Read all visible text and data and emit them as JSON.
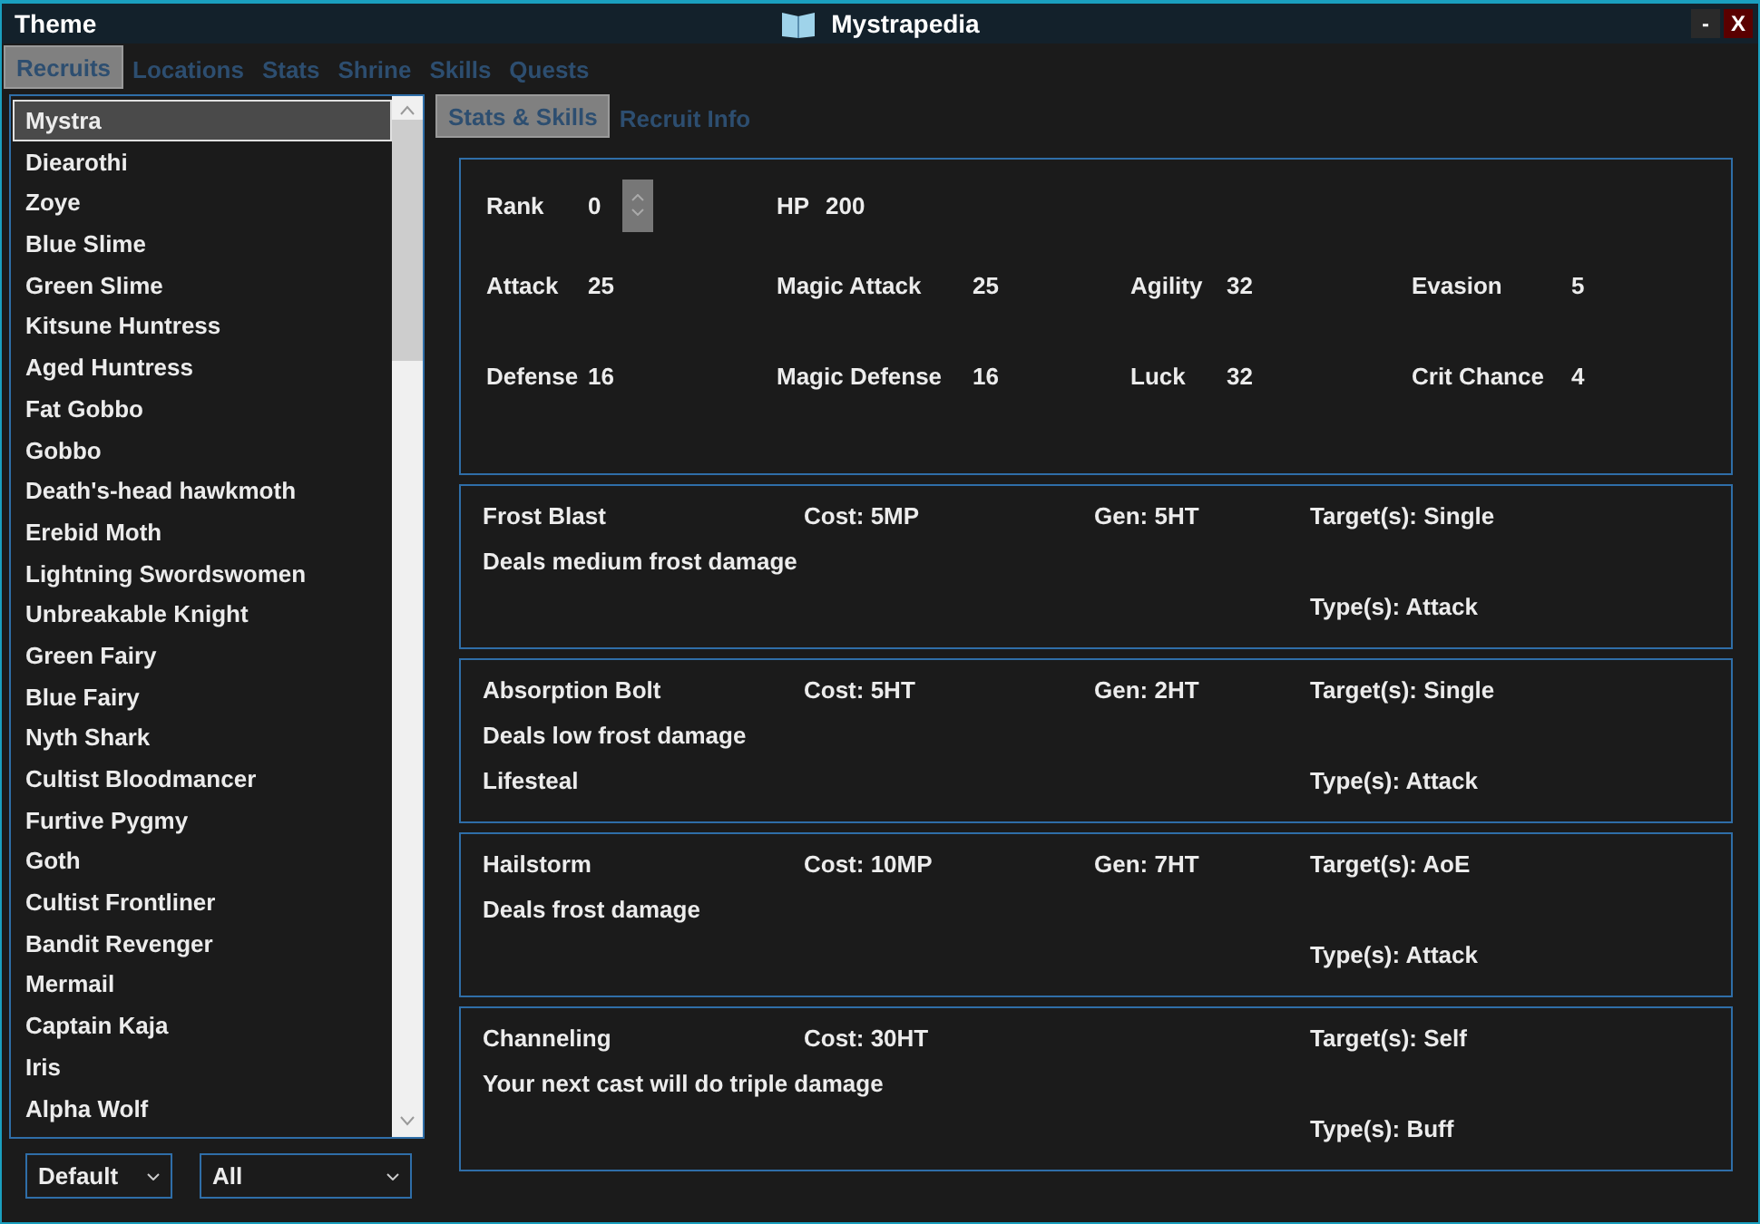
{
  "window": {
    "menu": "Theme",
    "title": "Mystrapedia",
    "minimize": "-",
    "close": "X"
  },
  "tabs": [
    {
      "label": "Recruits",
      "selected": true
    },
    {
      "label": "Locations",
      "selected": false
    },
    {
      "label": "Stats",
      "selected": false
    },
    {
      "label": "Shrine",
      "selected": false
    },
    {
      "label": "Skills",
      "selected": false
    },
    {
      "label": "Quests",
      "selected": false
    }
  ],
  "recruits": [
    {
      "name": "Mystra",
      "selected": true
    },
    {
      "name": "Diearothi",
      "selected": false
    },
    {
      "name": "Zoye",
      "selected": false
    },
    {
      "name": "Blue Slime",
      "selected": false
    },
    {
      "name": "Green Slime",
      "selected": false
    },
    {
      "name": "Kitsune Huntress",
      "selected": false
    },
    {
      "name": "Aged Huntress",
      "selected": false
    },
    {
      "name": "Fat Gobbo",
      "selected": false
    },
    {
      "name": "Gobbo",
      "selected": false
    },
    {
      "name": "Death's-head hawkmoth",
      "selected": false
    },
    {
      "name": "Erebid Moth",
      "selected": false
    },
    {
      "name": "Lightning Swordswomen",
      "selected": false
    },
    {
      "name": "Unbreakable Knight",
      "selected": false
    },
    {
      "name": "Green Fairy",
      "selected": false
    },
    {
      "name": "Blue Fairy",
      "selected": false
    },
    {
      "name": "Nyth Shark",
      "selected": false
    },
    {
      "name": "Cultist Bloodmancer",
      "selected": false
    },
    {
      "name": "Furtive Pygmy",
      "selected": false
    },
    {
      "name": "Goth",
      "selected": false
    },
    {
      "name": "Cultist Frontliner",
      "selected": false
    },
    {
      "name": "Bandit Revenger",
      "selected": false
    },
    {
      "name": "Mermail",
      "selected": false
    },
    {
      "name": "Captain Kaja",
      "selected": false
    },
    {
      "name": "Iris",
      "selected": false
    },
    {
      "name": "Alpha Wolf",
      "selected": false
    }
  ],
  "filters": [
    {
      "value": "Default"
    },
    {
      "value": "All"
    }
  ],
  "subtabs": [
    {
      "label": "Stats & Skills",
      "selected": true
    },
    {
      "label": "Recruit Info",
      "selected": false
    }
  ],
  "rank": {
    "label": "Rank",
    "value": "0"
  },
  "hp": {
    "label": "HP",
    "value": "200"
  },
  "stats": [
    {
      "label": "Attack",
      "value": "25"
    },
    {
      "label": "Magic Attack",
      "value": "25"
    },
    {
      "label": "Agility",
      "value": "32"
    },
    {
      "label": "Evasion",
      "value": "5"
    },
    {
      "label": "Defense",
      "value": "16"
    },
    {
      "label": "Magic Defense",
      "value": "16"
    },
    {
      "label": "Luck",
      "value": "32"
    },
    {
      "label": "Crit Chance",
      "value": "4"
    }
  ],
  "skills": [
    {
      "name": "Frost Blast",
      "cost": "Cost: 5MP",
      "gen": "Gen: 5HT",
      "targets": "Target(s): Single",
      "description": [
        "Deals medium frost damage"
      ],
      "types": "Type(s): Attack"
    },
    {
      "name": "Absorption Bolt",
      "cost": "Cost: 5HT",
      "gen": "Gen: 2HT",
      "targets": "Target(s): Single",
      "description": [
        "Deals low frost damage",
        "Lifesteal"
      ],
      "types": "Type(s): Attack"
    },
    {
      "name": "Hailstorm",
      "cost": "Cost: 10MP",
      "gen": "Gen: 7HT",
      "targets": "Target(s): AoE",
      "description": [
        "Deals frost damage"
      ],
      "types": "Type(s): Attack"
    },
    {
      "name": "Channeling",
      "cost": "Cost: 30HT",
      "targets": "Target(s): Self",
      "description": [
        "Your next cast will do triple damage"
      ],
      "types": "Type(s): Buff"
    }
  ]
}
